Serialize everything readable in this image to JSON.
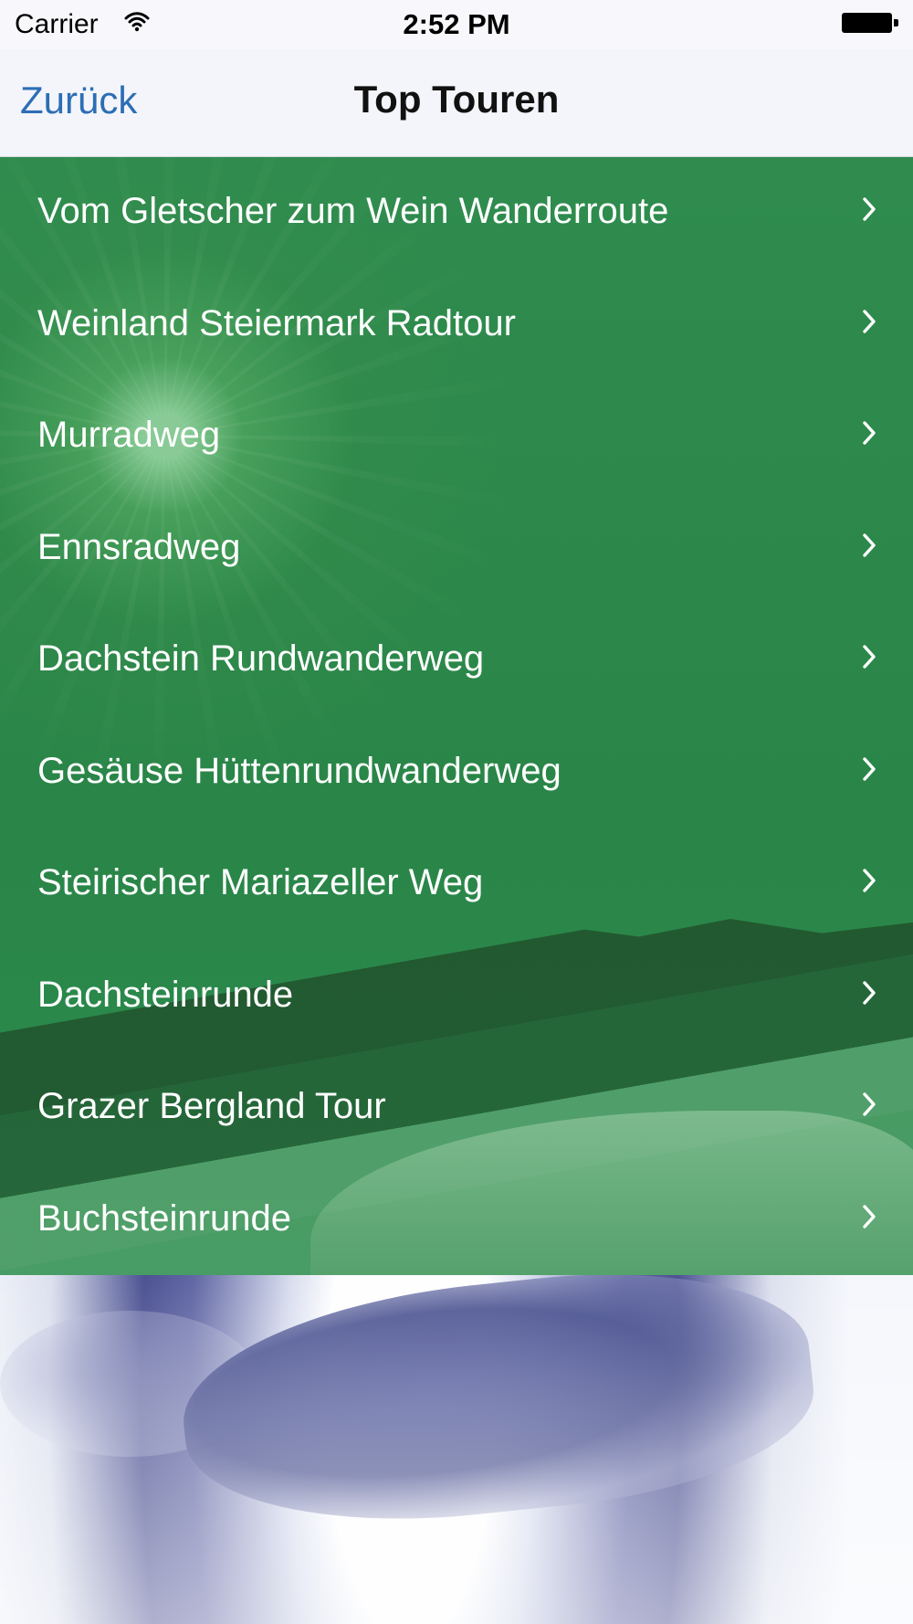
{
  "status_bar": {
    "carrier": "Carrier",
    "time": "2:52 PM"
  },
  "nav_bar": {
    "back_label": "Zurück",
    "title": "Top Touren"
  },
  "tours": [
    {
      "label": "Vom Gletscher zum Wein Wanderroute"
    },
    {
      "label": "Weinland Steiermark Radtour"
    },
    {
      "label": "Murradweg"
    },
    {
      "label": "Ennsradweg"
    },
    {
      "label": "Dachstein Rundwanderweg"
    },
    {
      "label": "Gesäuse Hüttenrundwanderweg"
    },
    {
      "label": "Steirischer Mariazeller Weg"
    },
    {
      "label": "Dachsteinrunde"
    },
    {
      "label": "Grazer Bergland Tour"
    },
    {
      "label": "Buchsteinrunde"
    }
  ],
  "icons": {
    "wifi": "wifi-icon",
    "battery": "battery-icon",
    "chevron": "chevron-right-icon"
  },
  "colors": {
    "accent_blue": "#2c6eb5",
    "panel_green": "#2a8648",
    "text_white": "#ffffff"
  }
}
